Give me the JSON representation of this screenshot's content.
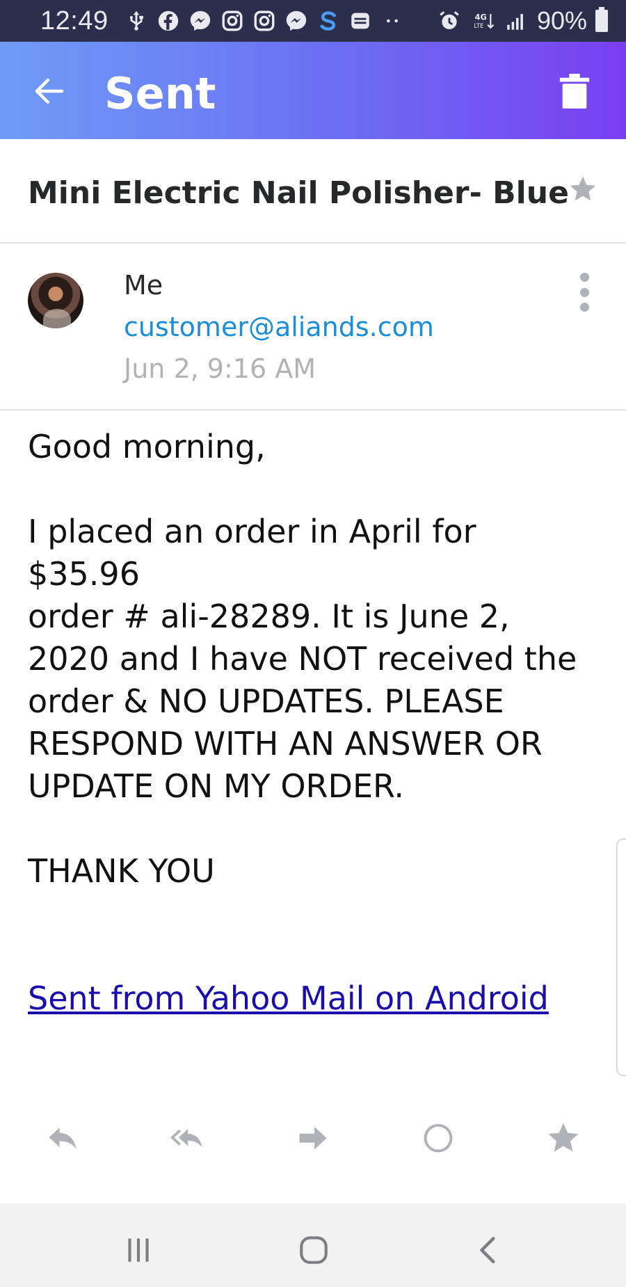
{
  "status_bar": {
    "time": "12:49",
    "battery": "90%",
    "notification_icons": [
      "usb-icon",
      "facebook-icon",
      "messenger-icon",
      "instagram-icon",
      "instagram-icon",
      "messenger-icon",
      "s-app-icon",
      "mail-icon",
      "more-dots-icon"
    ],
    "system_icons": [
      "alarm-icon",
      "lte-icon",
      "signal-icon",
      "battery-icon"
    ]
  },
  "header": {
    "title": "Sent",
    "back_icon": "arrow-left-icon",
    "delete_icon": "trash-icon",
    "gradient": [
      "#6f9cf7",
      "#6b6df2",
      "#7a3ff0"
    ]
  },
  "message": {
    "subject": "Mini Electric Nail Polisher- Blue",
    "starred": false,
    "sender_name": "Me",
    "sender_email": "customer@aliands.com",
    "date": "Jun 2, 9:16 AM",
    "body": {
      "greeting": "Good morning,",
      "line1": "I placed an order in April for $35.96",
      "line2": "order # ali-28289.  It is June 2,",
      "line3": "2020 and I have NOT received the",
      "line4": "order & NO UPDATES.  PLEASE",
      "line5": "RESPOND WITH AN ANSWER OR",
      "line6": "UPDATE ON MY ORDER.",
      "closing": "THANK YOU",
      "signature": "Sent from Yahoo Mail on Android"
    }
  },
  "actions": [
    "reply-icon",
    "reply-all-icon",
    "forward-icon",
    "mark-unread-icon",
    "star-icon"
  ],
  "android_nav": [
    "recent-apps-icon",
    "home-icon",
    "back-icon"
  ],
  "colors": {
    "status_bar_bg": "#2b2f4c",
    "link_blue": "#1a8ed8",
    "signature_link": "#1a0dab",
    "muted_gray": "#b0b2b8"
  }
}
